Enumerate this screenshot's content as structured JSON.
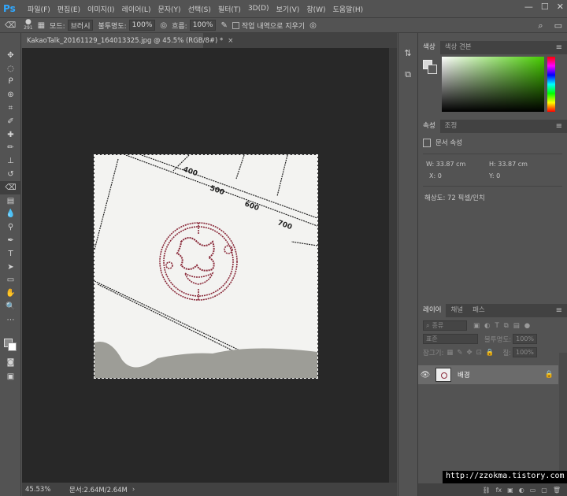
{
  "app": {
    "logo": "Ps"
  },
  "menu": [
    "파일(F)",
    "편집(E)",
    "이미지(I)",
    "레이어(L)",
    "문자(Y)",
    "선택(S)",
    "필터(T)",
    "3D(D)",
    "보기(V)",
    "창(W)",
    "도움말(H)"
  ],
  "window_controls": {
    "minimize": "—",
    "maximize": "☐",
    "close": "✕"
  },
  "options": {
    "brush_size": "291",
    "mode_label": "모드:",
    "mode_value": "브러시",
    "opacity_label": "불투명도:",
    "opacity_value": "100%",
    "flow_label": "흐름:",
    "flow_value": "100%",
    "erase_history_label": "작업 내역으로 지우기"
  },
  "document": {
    "tab_title": "KakaoTalk_20161129_164013325.jpg @ 45.5% (RGB/8#) *",
    "zoom": "45.53%",
    "doc_info": "문서:2.64M/2.64M"
  },
  "color_panel": {
    "tabs": [
      "색상",
      "색상 견본"
    ],
    "colors": {
      "accent": "#46cc00",
      "stamp": "#8a2a3a"
    }
  },
  "properties_panel": {
    "tabs": [
      "속성",
      "조정"
    ],
    "title": "문서 속성",
    "w_label": "W:",
    "w_value": "33.87 cm",
    "h_label": "H:",
    "h_value": "33.87 cm",
    "x_label": "X:",
    "x_value": "0",
    "y_label": "Y:",
    "y_value": "0",
    "resolution": "해상도: 72 픽셀/인치"
  },
  "layers_panel": {
    "tabs": [
      "레이어",
      "채널",
      "패스"
    ],
    "filter_label": "종류",
    "blend_mode": "표준",
    "opacity_label": "불투명도:",
    "opacity_value": "100%",
    "lock_label": "잠그기:",
    "fill_label": "칠:",
    "fill_value": "100%",
    "layer_name": "배경",
    "bottom_icons": [
      "ⓕⓧ",
      "◐",
      "▣",
      "▢",
      "🗑"
    ]
  },
  "watermark": "http://zzokma.tistory.com"
}
